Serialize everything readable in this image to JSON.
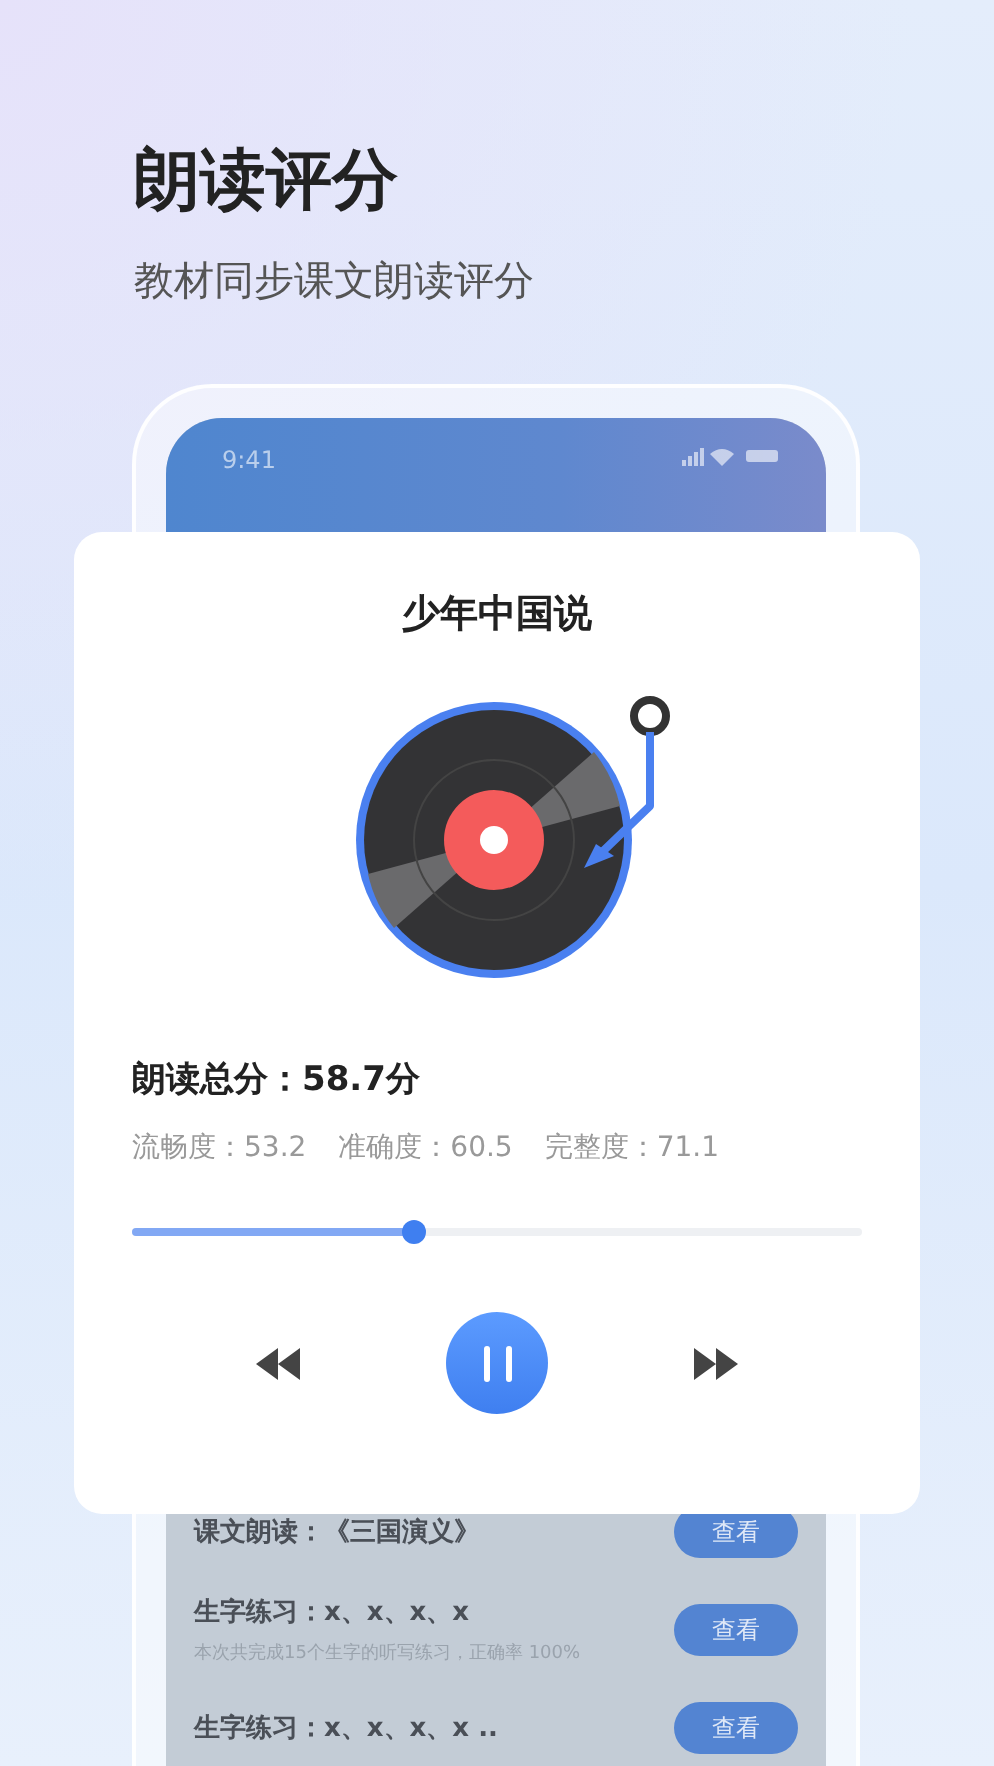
{
  "header": {
    "title": "朗读评分",
    "subtitle": "教材同步课文朗读评分"
  },
  "phone": {
    "status_bar": {
      "time": "9:41"
    },
    "records": [
      {
        "title": "课文朗读：《三国演义》",
        "button": "查看"
      },
      {
        "title": "生字练习：x、x、x、x",
        "description": "本次共完成15个生字的听写练习，正确率 100%",
        "button": "查看"
      },
      {
        "title": "生字练习：x、x、x、x ..",
        "button": "查看"
      }
    ]
  },
  "player": {
    "title": "少年中国说",
    "total_score": "朗读总分：58.7分",
    "metrics": [
      "流畅度：53.2",
      "准确度：60.5",
      "完整度：71.1"
    ],
    "progress": {
      "level": 0.385
    },
    "playing": true
  }
}
